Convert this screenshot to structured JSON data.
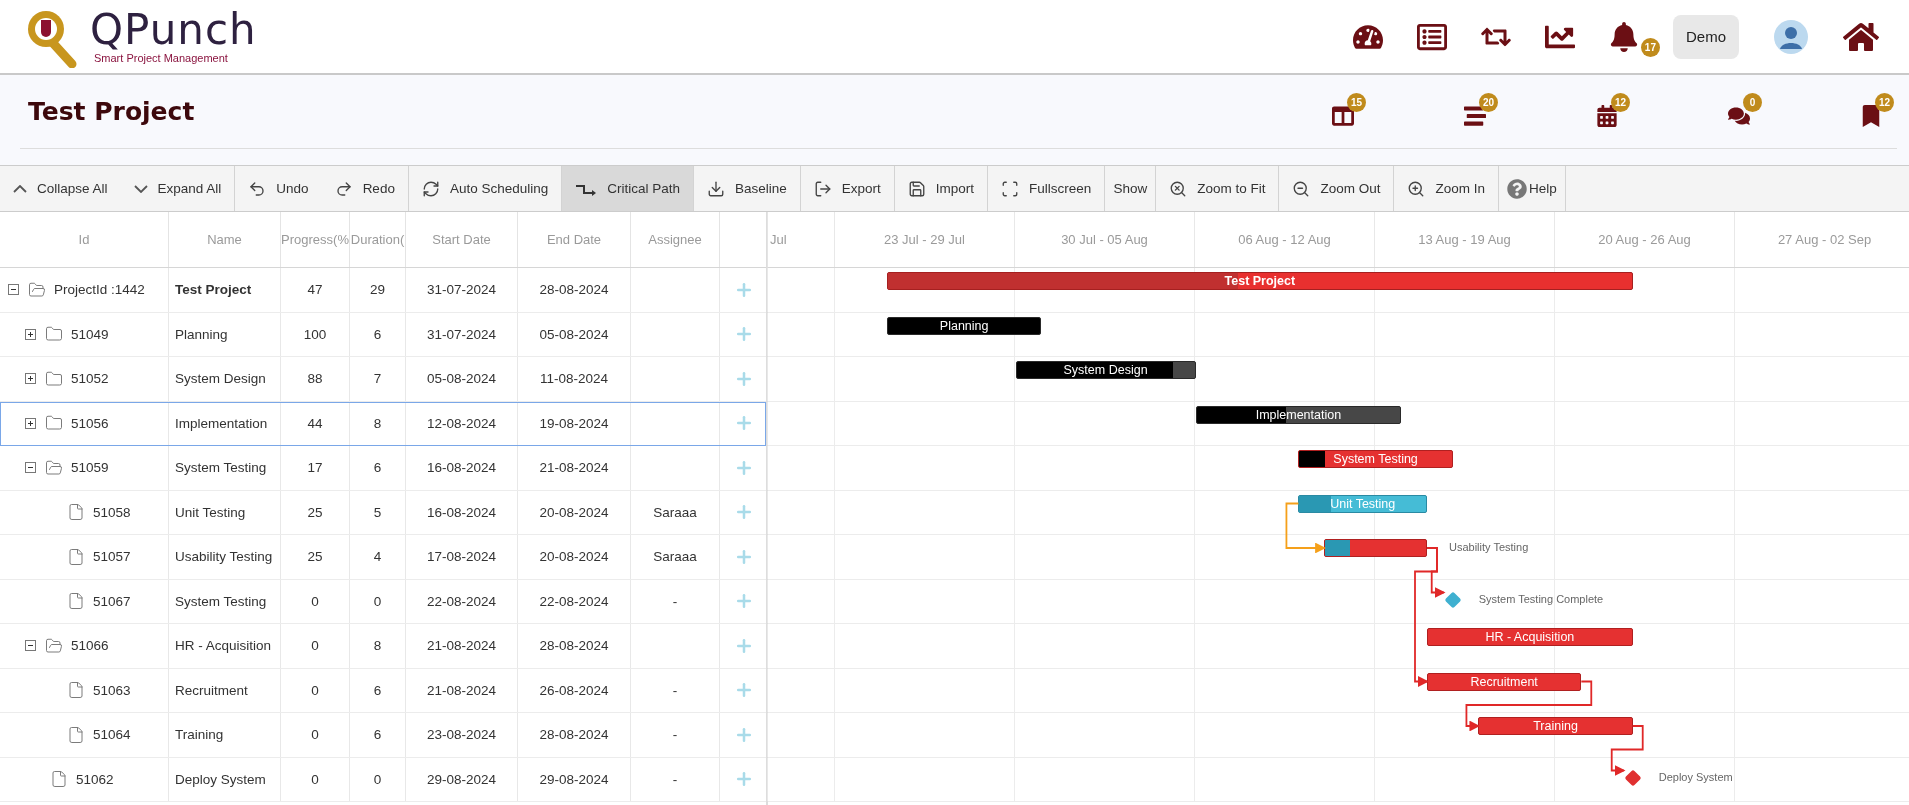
{
  "app": {
    "logo_title": "QPunch",
    "logo_subtitle": "Smart Project Management"
  },
  "header_actions": [
    {
      "kind": "dashboard"
    },
    {
      "kind": "list"
    },
    {
      "kind": "sync"
    },
    {
      "kind": "chart"
    },
    {
      "kind": "notifications",
      "count": "17"
    }
  ],
  "user_button": "Demo",
  "project": {
    "title": "Test Project",
    "counters": [
      {
        "kind": "board",
        "count": "15"
      },
      {
        "kind": "tasks",
        "count": "20"
      },
      {
        "kind": "calendar",
        "count": "12"
      },
      {
        "kind": "comments",
        "count": "0"
      },
      {
        "kind": "documents",
        "count": "12"
      }
    ]
  },
  "toolbar": {
    "groups": [
      [
        {
          "label": "Collapse All",
          "selected": false
        },
        {
          "label": "Expand All",
          "selected": false
        }
      ],
      [
        {
          "label": "Undo",
          "selected": false
        },
        {
          "label": "Redo",
          "selected": false
        }
      ],
      [
        {
          "label": "Auto Scheduling",
          "selected": false
        }
      ],
      [
        {
          "label": "Critical Path",
          "selected": true
        }
      ],
      [
        {
          "label": "Baseline",
          "selected": false
        }
      ],
      [
        {
          "label": "Export",
          "selected": false
        }
      ],
      [
        {
          "label": "Import",
          "selected": false
        }
      ],
      [
        {
          "label": "Fullscreen",
          "selected": false
        }
      ],
      [
        {
          "label": "Show",
          "selected": false
        }
      ],
      [
        {
          "label": "Zoom to Fit",
          "selected": false
        }
      ],
      [
        {
          "label": "Zoom Out",
          "selected": false
        }
      ],
      [
        {
          "label": "Zoom In",
          "selected": false
        }
      ],
      [
        {
          "label": "Help",
          "selected": false
        }
      ]
    ]
  },
  "grid": {
    "columns": [
      "Id",
      "Name",
      "Progress(%",
      "Duration(",
      "Start Date",
      "End Date",
      "Assignee"
    ],
    "rows": [
      {
        "id": "ProjectId :1442",
        "name": "Test Project",
        "progress": "47",
        "duration": "29",
        "start": "31-07-2024",
        "end": "28-08-2024",
        "kind": "project",
        "critical": true,
        "bar_label": "Test Project",
        "level": 0.47,
        "expanded": true,
        "selected": false,
        "children": [
          {
            "id": "51049",
            "name": "Planning",
            "progress": "100",
            "duration": "6",
            "start": "31-07-2024",
            "end": "05-08-2024",
            "kind": "summary",
            "critical": false,
            "bar_label": "Planning",
            "level": 1,
            "expanded": false,
            "selected": false
          },
          {
            "id": "51052",
            "name": "System Design",
            "progress": "88",
            "duration": "7",
            "start": "05-08-2024",
            "end": "11-08-2024",
            "kind": "summary",
            "critical": false,
            "bar_label": "System Design",
            "level": 0.88,
            "expanded": false,
            "selected": false
          },
          {
            "id": "51056",
            "name": "Implementation",
            "progress": "44",
            "duration": "8",
            "start": "12-08-2024",
            "end": "19-08-2024",
            "kind": "summary",
            "critical": false,
            "bar_label": "Implementation",
            "level": 0.44,
            "expanded": false,
            "selected": true
          },
          {
            "id": "51059",
            "name": "System Testing",
            "progress": "17",
            "duration": "6",
            "start": "16-08-2024",
            "end": "21-08-2024",
            "kind": "summary",
            "critical": true,
            "bar_label": "System Testing",
            "level": 0.17,
            "expanded": true,
            "selected": false,
            "children": [
              {
                "id": "51058",
                "name": "Unit Testing",
                "progress": "25",
                "duration": "5",
                "start": "16-08-2024",
                "end": "20-08-2024",
                "assignee": "Saraaa",
                "kind": "task",
                "critical": false,
                "bar_label": "Unit Testing",
                "level": 0.25,
                "selected": false
              },
              {
                "id": "51057",
                "name": "Usability Testing",
                "progress": "25",
                "duration": "4",
                "start": "17-08-2024",
                "end": "20-08-2024",
                "assignee": "Saraaa",
                "kind": "task",
                "critical": true,
                "predecessors": [
                  {
                    "kind": "start-to-start",
                    "critical": false
                  }
                ],
                "bar_label": "Usability Testing",
                "label_outside": true,
                "level": 0.25,
                "selected": false
              },
              {
                "id": "51067",
                "name": "System Testing",
                "progress": "0",
                "duration": "0",
                "start": "22-08-2024",
                "end": "22-08-2024",
                "assignee": "-",
                "kind": "milestone",
                "critical": false,
                "predecessors": [
                  {
                    "kind": "finish-to-start",
                    "critical": true
                  }
                ],
                "bar_label": "System Testing Complete",
                "selected": false
              }
            ]
          },
          {
            "id": "51066",
            "name": "HR - Acquisition",
            "progress": "0",
            "duration": "8",
            "start": "21-08-2024",
            "end": "28-08-2024",
            "kind": "summary",
            "critical": true,
            "bar_label": "HR - Acquisition",
            "level": 0,
            "expanded": true,
            "selected": false,
            "children": [
              {
                "id": "51063",
                "name": "Recruitment",
                "progress": "0",
                "duration": "6",
                "start": "21-08-2024",
                "end": "26-08-2024",
                "assignee": "-",
                "kind": "task",
                "critical": true,
                "predecessors": [
                  {
                    "kind": "finish-to-start",
                    "critical": true
                  }
                ],
                "bar_label": "Recruitment",
                "level": 0,
                "selected": false
              },
              {
                "id": "51064",
                "name": "Training",
                "progress": "0",
                "duration": "6",
                "start": "23-08-2024",
                "end": "28-08-2024",
                "assignee": "-",
                "kind": "task",
                "critical": true,
                "predecessors": [
                  {
                    "kind": "finish-to-start",
                    "critical": true
                  }
                ],
                "bar_label": "Training",
                "level": 0,
                "selected": false
              }
            ]
          },
          {
            "id": "51062",
            "name": "Deploy System",
            "progress": "0",
            "duration": "0",
            "start": "29-08-2024",
            "end": "29-08-2024",
            "assignee": "-",
            "kind": "milestone",
            "critical": true,
            "predecessors": [
              {
                "kind": "finish-to-start",
                "critical": true
              }
            ],
            "bar_label": "Deploy System",
            "selected": false
          }
        ]
      }
    ]
  },
  "timeline": {
    "scale": [
      "Jul",
      "23 Jul - 29 Jul",
      "30 Jul - 05 Aug",
      "06 Aug - 12 Aug",
      "13 Aug - 19 Aug",
      "20 Aug - 26 Aug",
      "27 Aug - 02 Sep"
    ]
  }
}
